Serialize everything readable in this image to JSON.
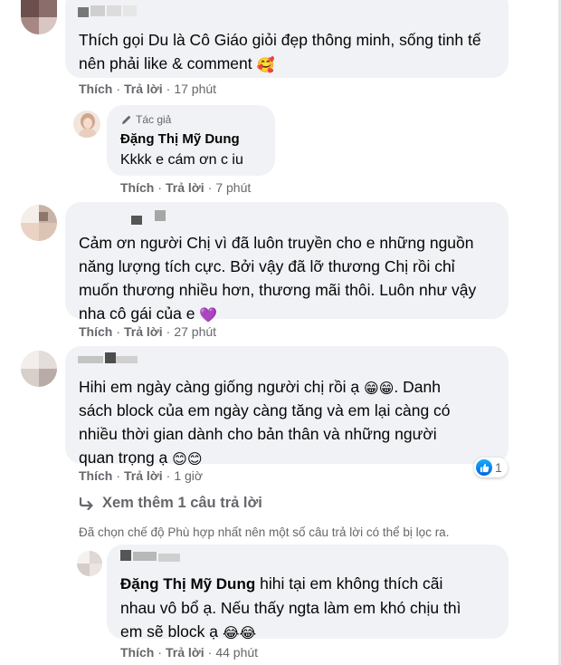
{
  "comments": [
    {
      "id": "c1",
      "name_blurred": true,
      "text": "Thích gọi Du là Cô Giáo giỏi đẹp thông minh, sống tinh tế nên phải like & comment",
      "emoji": "🥰",
      "actions": {
        "like": "Thích",
        "reply": "Trả lời",
        "time": "17 phút"
      }
    },
    {
      "id": "r1",
      "author_badge": "Tác giả",
      "name": "Đặng Thị Mỹ Dung",
      "text": "Kkkk e cám ơn c iu",
      "actions": {
        "like": "Thích",
        "reply": "Trả lời",
        "time": "7 phút"
      }
    },
    {
      "id": "c2",
      "name_blurred": true,
      "text_lines": [
        "Cảm ơn người Chị vì đã luôn truyền cho e những nguồn",
        "năng lượng tích cực. Bởi vậy đã lỡ thương Chị rồi chỉ",
        "muốn thương nhiều hơn, thương mãi thôi. Luôn như vậy",
        "nha cô gái của e"
      ],
      "emoji": "💜",
      "actions": {
        "like": "Thích",
        "reply": "Trả lời",
        "time": "27 phút"
      }
    },
    {
      "id": "c3",
      "name_blurred": true,
      "text_lines": [
        "Hihi em ngày càng giống người chị rồi ạ",
        ". Danh",
        "sách block của em ngày càng tăng và em lại càng có",
        "nhiều thời gian dành cho bản thân và những người",
        "quan trọng ạ"
      ],
      "emoji_grin": "😁😁",
      "emoji_smile": "😊😊",
      "actions": {
        "like": "Thích",
        "reply": "Trả lời",
        "time": "1 giờ"
      },
      "reaction_count": "1"
    },
    {
      "id": "r2",
      "name": "Đặng Thị Mỹ Dung",
      "text_first": "hihi tại em không thích cãi",
      "text_lines": [
        "nhau vô bổ ạ. Nếu thấy ngta làm em khó chịu thì",
        "em sẽ block ạ"
      ],
      "emoji": "😂😂",
      "actions": {
        "like": "Thích",
        "reply": "Trả lời",
        "time": "44 phút"
      }
    }
  ],
  "more_replies": "Xem thêm 1 câu trả lời",
  "filter_note": "Đã chọn chế độ Phù hợp nhất nên một số câu trả lời có thể bị lọc ra.",
  "colors": {
    "bubble": "#f0f2f5",
    "secondary_text": "#65676b",
    "like_blue": "#0165e1",
    "primary_text": "#050505"
  },
  "icons": {
    "pencil": "pencil-icon",
    "reply_arrow": "reply-arrow-icon",
    "like": "like-icon"
  }
}
